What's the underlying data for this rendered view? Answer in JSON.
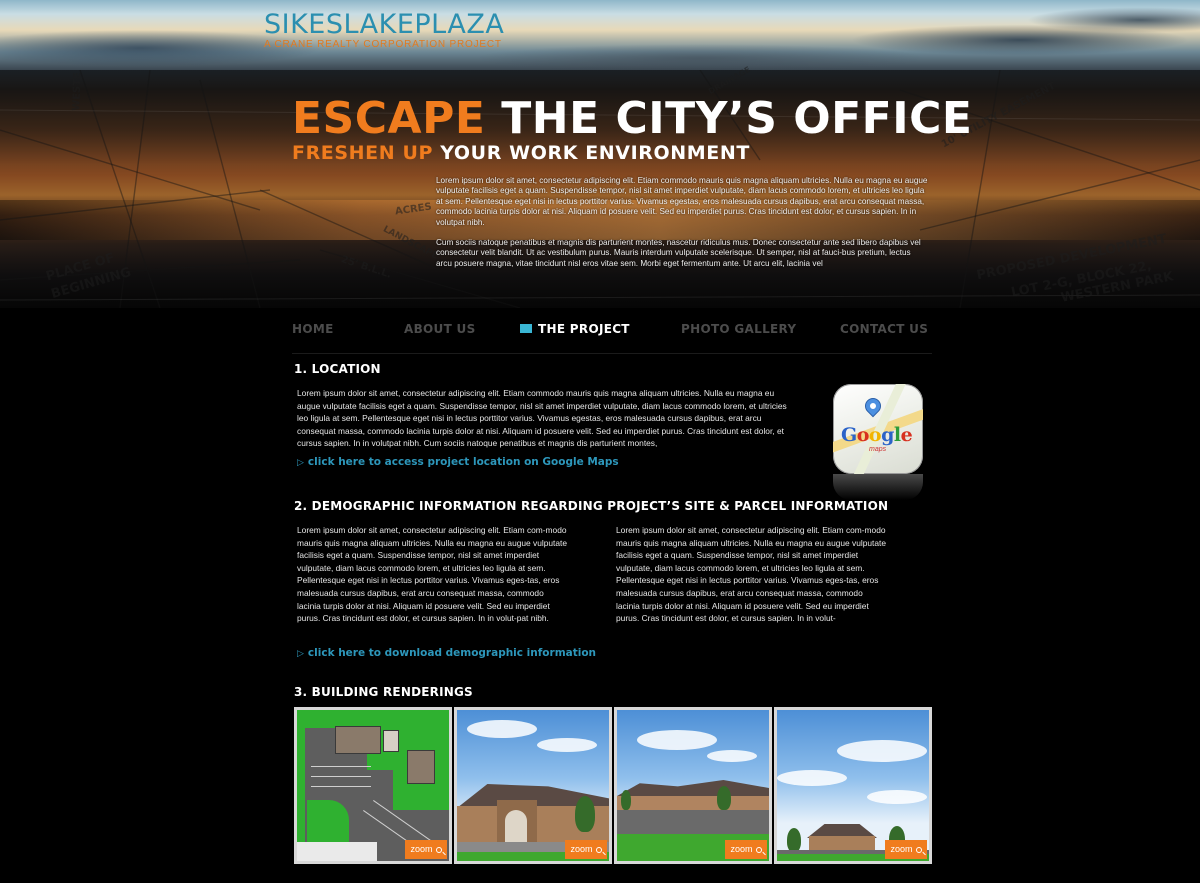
{
  "site": {
    "title": "SIKESLAKEPLAZA",
    "subtitle": "A CRANE REALTY CORPORATION PROJECT"
  },
  "hero": {
    "headline_orange": "ESCAPE",
    "headline_white": " THE CITY’S OFFICE",
    "subhead_orange": "FRESHEN UP",
    "subhead_white": " YOUR WORK ENVIRONMENT",
    "intro_p1": "Lorem ipsum dolor sit amet, consectetur adipiscing elit. Etiam commodo mauris quis magna aliquam ultricies. Nulla eu magna eu augue vulputate facilisis eget a quam. Suspendisse tempor, nisl sit amet imperdiet vulputate, diam lacus commodo lorem, et ultricies leo ligula at sem. Pellentesque eget nisi in lectus porttitor varius. Vivamus egestas, eros malesuada cursus dapibus, erat arcu consequat massa, commodo lacinia turpis dolor at nisi. Aliquam id posuere velit. Sed eu imperdiet purus. Cras tincidunt est dolor, et cursus sapien. In in volutpat nibh.",
    "intro_p2": "Cum sociis natoque penatibus et magnis dis parturient montes, nascetur ridiculus mus. Donec consectetur ante sed libero dapibus vel consectetur velit blandit. Ut ac vestibulum purus. Mauris interdum vulputate scelerisque. Ut semper, nisl at fauci-bus pretium, lectus arcu posuere magna, vitae tincidunt nisl eros vitae sem. Morbi eget fermentum ante. Ut arcu elit, lacinia vel",
    "blueprint_labels": [
      "PROPOSED DEVELOPMENT",
      "LOT 2-G, BLOCK 22,",
      "WESTERN PARK",
      "PLACE OF",
      "BEGINNING",
      "10' UTILITY EASEMENT",
      "LANDSCAPE",
      "25' B.L.L.",
      "DRAINAGE",
      "ACRES",
      "WESTE"
    ]
  },
  "nav": {
    "items": [
      {
        "label": "HOME"
      },
      {
        "label": "ABOUT US"
      },
      {
        "label": "THE PROJECT"
      },
      {
        "label": "PHOTO GALLERY"
      },
      {
        "label": "CONTACT US"
      }
    ],
    "active": "THE PROJECT"
  },
  "location": {
    "title": "1. LOCATION",
    "text": "Lorem ipsum dolor sit amet, consectetur adipiscing elit. Etiam commodo mauris quis magna aliquam ultricies. Nulla eu magna eu augue vulputate facilisis eget a quam. Suspendisse tempor, nisl sit amet imperdiet vulputate, diam lacus commodo lorem, et ultricies leo ligula at sem. Pellentesque eget nisi in lectus porttitor varius. Vivamus egestas, eros malesuada cursus dapibus, erat arcu consequat massa, commodo lacinia turpis dolor at nisi. Aliquam id posuere velit. Sed eu imperdiet purus. Cras tincidunt est dolor, et cursus sapien. In in volutpat nibh. Cum sociis natoque penatibus et magnis dis parturient montes,",
    "link": "click here to access project location on Google Maps",
    "icon_word": "Google",
    "icon_sub": "maps"
  },
  "demographic": {
    "title": "2. DEMOGRAPHIC INFORMATION REGARDING PROJECT’S SITE & PARCEL INFORMATION",
    "col1": "Lorem ipsum dolor sit amet, consectetur adipiscing elit. Etiam com-modo mauris quis magna aliquam ultricies. Nulla eu magna eu augue vulputate facilisis eget a quam. Suspendisse tempor, nisl sit amet imperdiet vulputate, diam lacus commodo lorem, et ultricies leo ligula at sem. Pellentesque eget nisi in lectus porttitor varius. Vivamus eges-tas, eros malesuada cursus dapibus, erat arcu consequat massa, commodo lacinia turpis dolor at nisi. Aliquam id posuere velit. Sed eu imperdiet purus. Cras tincidunt est dolor, et cursus sapien. In in volut-pat nibh.",
    "col2": "Lorem ipsum dolor sit amet, consectetur adipiscing elit. Etiam com-modo mauris quis magna aliquam ultricies. Nulla eu magna eu augue vulputate facilisis eget a quam. Suspendisse tempor, nisl sit amet imperdiet vulputate, diam lacus commodo lorem, et ultricies leo ligula at sem. Pellentesque eget nisi in lectus porttitor varius. Vivamus eges-tas, eros malesuada cursus dapibus, erat arcu consequat massa, commodo lacinia turpis dolor at nisi. Aliquam id posuere velit. Sed eu imperdiet purus. Cras tincidunt est dolor, et cursus sapien. In in volut-",
    "link": "click here to download demographic information"
  },
  "renderings": {
    "title": "3. BUILDING RENDERINGS",
    "zoom_label": "zoom",
    "thumbs": [
      {
        "name": "site-plan"
      },
      {
        "name": "front-facade"
      },
      {
        "name": "parking-view"
      },
      {
        "name": "wide-view"
      }
    ]
  },
  "colors": {
    "accent_orange": "#f07c1e",
    "accent_blue": "#2d97bb",
    "logo_blue": "#2b8fb0",
    "nav_marker": "#3ab6d4",
    "background": "#000000"
  }
}
